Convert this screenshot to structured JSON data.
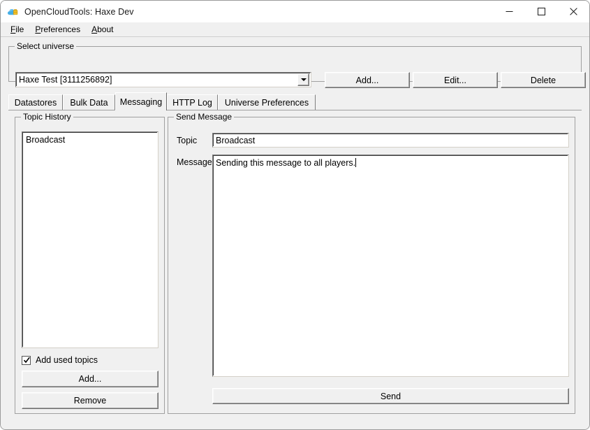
{
  "window": {
    "title": "OpenCloudTools: Haxe Dev",
    "icon": "cloud-toolbox-icon",
    "controls": {
      "minimize": "minimize-icon",
      "maximize": "maximize-icon",
      "close": "close-icon"
    }
  },
  "menubar": {
    "items": [
      {
        "label": "File",
        "accel": "F"
      },
      {
        "label": "Preferences",
        "accel": "P"
      },
      {
        "label": "About",
        "accel": "A"
      }
    ]
  },
  "universe": {
    "legend": "Select universe",
    "selected": "Haxe Test [3111256892]",
    "options": [
      "Haxe Test [3111256892]"
    ],
    "dropdown_icon": "chevron-down-icon",
    "add_label": "Add...",
    "edit_label": "Edit...",
    "delete_label": "Delete"
  },
  "tabs": [
    {
      "label": "Datastores",
      "selected": false
    },
    {
      "label": "Bulk Data",
      "selected": false
    },
    {
      "label": "Messaging",
      "selected": true
    },
    {
      "label": "HTTP Log",
      "selected": false
    },
    {
      "label": "Universe Preferences",
      "selected": false
    }
  ],
  "topic_history": {
    "legend": "Topic History",
    "items": [
      "Broadcast"
    ],
    "checkbox": {
      "label": "Add used topics",
      "checked": true,
      "icon": "checkmark-icon"
    },
    "add_label": "Add...",
    "remove_label": "Remove"
  },
  "send_message": {
    "legend": "Send Message",
    "topic_label": "Topic",
    "topic_value": "Broadcast",
    "topic_placeholder": "",
    "message_label": "Message",
    "message_value": "Sending this message to all players.",
    "message_placeholder": "",
    "send_label": "Send"
  },
  "colors": {
    "window_bg": "#f0f0f0",
    "titlebar_bg": "#ffffff",
    "field_bg": "#ffffff",
    "border": "#a0a0a0",
    "text": "#000000",
    "icon_cloud": "#3aa3e3",
    "icon_box": "#f5c93a",
    "close_hover": "#e81123"
  }
}
